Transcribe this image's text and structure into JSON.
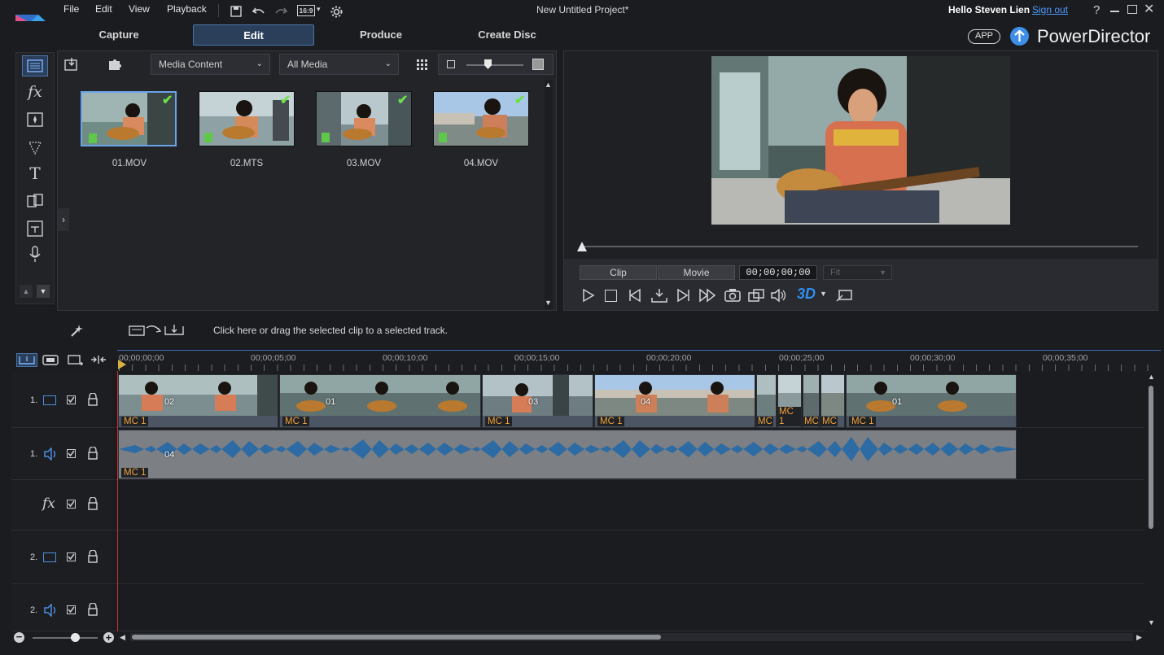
{
  "menu": {
    "file": "File",
    "edit": "Edit",
    "view": "View",
    "playback": "Playback",
    "aspect": "16:9"
  },
  "window": {
    "title": "New Untitled Project*",
    "greeting": "Hello Steven Lien",
    "signout": "Sign out",
    "help": "?"
  },
  "tabs": {
    "capture": "Capture",
    "edit": "Edit",
    "produce": "Produce",
    "create_disc": "Create Disc"
  },
  "brand": {
    "app_badge": "APP",
    "name": "PowerDirector"
  },
  "library": {
    "content_dropdown": "Media Content",
    "filter_dropdown": "All Media",
    "items": [
      {
        "name": "01.MOV"
      },
      {
        "name": "02.MTS"
      },
      {
        "name": "03.MOV"
      },
      {
        "name": "04.MOV"
      }
    ]
  },
  "preview": {
    "clip_label": "Clip",
    "movie_label": "Movie",
    "timecode": "00;00;00;00",
    "fit_label": "Fit",
    "mode_3d": "3D"
  },
  "hint": "Click here or drag the selected clip to a selected track.",
  "ruler": [
    "00;00;00;00",
    "00;00;05;00",
    "00;00;10;00",
    "00;00;15;00",
    "00;00;20;00",
    "00;00;25;00",
    "00;00;30;00",
    "00;00;35;00"
  ],
  "tracks": {
    "video1": "1.",
    "audio1": "1.",
    "video2": "2.",
    "audio2": "2."
  },
  "clips": {
    "video": [
      {
        "label": "MC 1",
        "num": "02"
      },
      {
        "label": "MC 1",
        "num": "01"
      },
      {
        "label": "MC 1",
        "num": "03"
      },
      {
        "label": "MC 1",
        "num": "04"
      },
      {
        "label": "MC",
        "num": ""
      },
      {
        "label": "MC 1",
        "num": ""
      },
      {
        "label": "MC",
        "num": ""
      },
      {
        "label": "MC",
        "num": ""
      },
      {
        "label": "MC 1",
        "num": "01"
      }
    ],
    "audio": {
      "label": "MC 1",
      "num": "04"
    }
  },
  "colors": {
    "accent": "#3d8ee6",
    "clip_label": "#f0a23a",
    "waveform": "#2c6ba3",
    "playhead": "#d03030"
  }
}
